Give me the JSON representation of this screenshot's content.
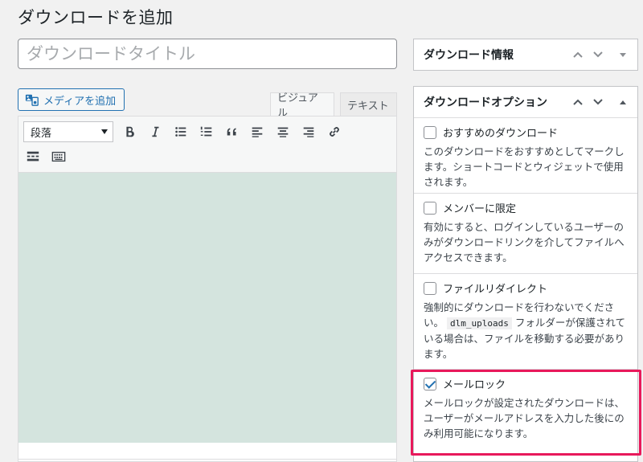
{
  "page": {
    "title": "ダウンロードを追加",
    "title_placeholder": "ダウンロードタイトル"
  },
  "editor": {
    "media_button": "メディアを追加",
    "tabs": [
      "ビジュアル",
      "テキスト"
    ],
    "format_select": "段落",
    "toolbar_icons": [
      "bold-icon",
      "italic-icon",
      "bullet-list-icon",
      "numbered-list-icon",
      "blockquote-icon",
      "align-left-icon",
      "align-center-icon",
      "align-right-icon",
      "link-icon",
      "read-more-icon",
      "toolbar-toggle-icon"
    ],
    "content_bg": "#d4e4de"
  },
  "download_info": {
    "title": "ダウンロード情報"
  },
  "download_options": {
    "title": "ダウンロードオプション",
    "options": [
      {
        "label": "おすすめのダウンロード",
        "checked": false,
        "description": "このダウンロードをおすすめとしてマークします。ショートコードとウィジェットで使用されます。"
      },
      {
        "label": "メンバーに限定",
        "checked": false,
        "description": "有効にすると、ログインしているユーザーのみがダウンロードリンクを介してファイルへアクセスできます。"
      },
      {
        "label": "ファイルリダイレクト",
        "checked": false,
        "description_before": "強制的にダウンロードを行わないでください。",
        "description_code": "dlm_uploads",
        "description_after": "フォルダーが保護されている場合は、ファイルを移動する必要があります。"
      },
      {
        "label": "メールロック",
        "checked": true,
        "description": "メールロックが設定されたダウンロードは、ユーザーがメールアドレスを入力した後にのみ利用可能になります。"
      }
    ]
  },
  "colors": {
    "accent": "#2271b1",
    "highlight": "#e8195b"
  }
}
